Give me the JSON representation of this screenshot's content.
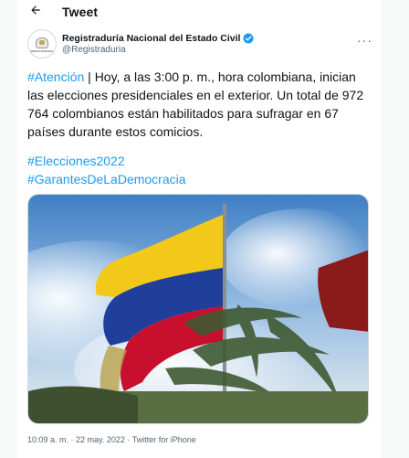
{
  "header": {
    "title": "Tweet"
  },
  "author": {
    "avatar_text": "REGISTRADURÍA",
    "name": "Registraduría Nacional del Estado Civil",
    "handle": "@Registraduria"
  },
  "tweet": {
    "attention_tag": "#Atención",
    "body_rest": " | Hoy, a las 3:00 p. m., hora colombiana, inician las elecciones presidenciales en el exterior. Un total de 972 764 colombianos están habilitados para sufragar en 67 países durante estos comicios.",
    "hashtags": [
      "#Elecciones2022",
      "#GarantesDeLaDemocracia"
    ]
  },
  "meta": {
    "timestamp": "10:09 a. m. · 22 may. 2022 · Twitter for iPhone"
  },
  "icons": {
    "back": "arrow-left-icon",
    "verified": "verified-badge-icon",
    "more": "more-options-icon"
  },
  "colors": {
    "link": "#1d9bf0",
    "text": "#0f1419",
    "secondary": "#536471"
  }
}
